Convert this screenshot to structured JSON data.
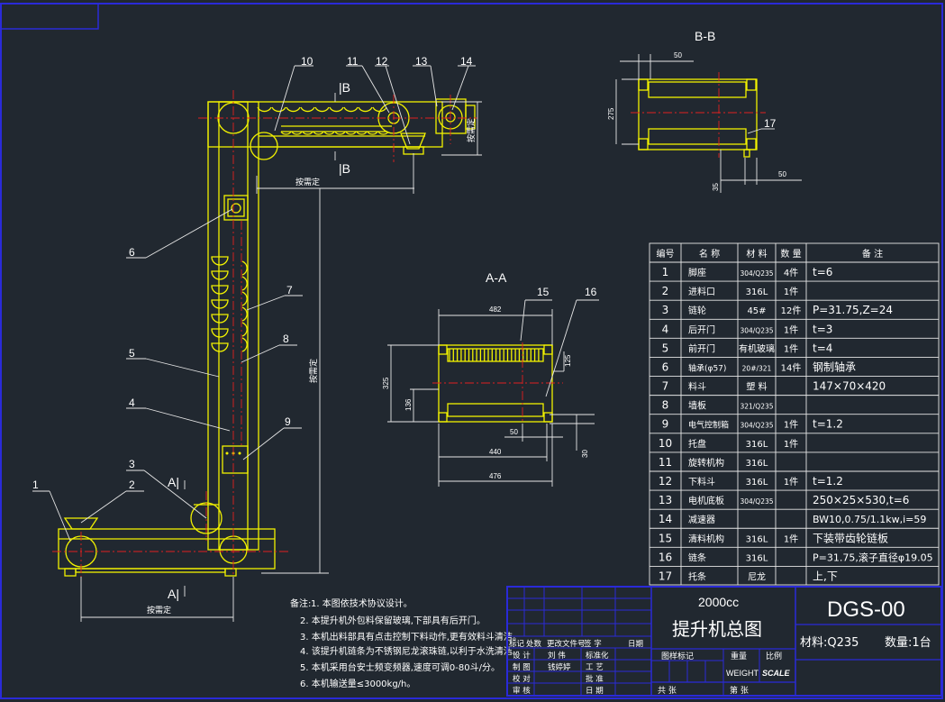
{
  "colors": {
    "background": "#212830",
    "frame_blue": "#2a2ad8",
    "outline_yellow": "#f2f200",
    "centerline_red": "#e02020",
    "text_white": "#ffffff"
  },
  "section_labels": {
    "b_b": "B-B",
    "a_a": "A-A",
    "b_top": "|B",
    "b_bottom": "|B",
    "a_top": "A|",
    "a_bottom": "A|"
  },
  "balloons": [
    "1",
    "2",
    "3",
    "4",
    "5",
    "6",
    "7",
    "8",
    "9",
    "10",
    "11",
    "12",
    "13",
    "14",
    "15",
    "16",
    "17"
  ],
  "dimensions": {
    "bb_50_top": "50",
    "bb_275": "275",
    "bb_35": "35",
    "bb_50_bottom": "50",
    "aa_482": "482",
    "aa_325": "325",
    "aa_136": "136",
    "aa_125": "125",
    "aa_50": "50",
    "aa_440": "440",
    "aa_476": "476",
    "aa_30": "30",
    "main_by_order_1": "按需定",
    "main_by_order_2": "按需定",
    "main_by_order_3": "按需定",
    "main_by_order_4": "按需定"
  },
  "parts_table": {
    "headers": [
      "编号",
      "名  称",
      "材 料",
      "数 量",
      "备     注"
    ],
    "rows": [
      [
        "1",
        "脚座",
        "304/Q235",
        "4件",
        "t=6"
      ],
      [
        "2",
        "进料口",
        "316L",
        "1件",
        ""
      ],
      [
        "3",
        "链轮",
        "45#",
        "12件",
        "P=31.75,Z=24"
      ],
      [
        "4",
        "后开门",
        "304/Q235",
        "1件",
        "t=3"
      ],
      [
        "5",
        "前开门",
        "有机玻璃",
        "1件",
        "t=4"
      ],
      [
        "6",
        "轴承(φ57)",
        "20#/321",
        "14件",
        "钢制轴承"
      ],
      [
        "7",
        "料斗",
        "塑 料",
        "",
        "147×70×420"
      ],
      [
        "8",
        "墙板",
        "321/Q235",
        "",
        ""
      ],
      [
        "9",
        "电气控制箱",
        "304/Q235",
        "1件",
        "t=1.2"
      ],
      [
        "10",
        "托盘",
        "316L",
        "1件",
        ""
      ],
      [
        "11",
        "旋转机构",
        "316L",
        "",
        ""
      ],
      [
        "12",
        "下料斗",
        "316L",
        "1件",
        "t=1.2"
      ],
      [
        "13",
        "电机底板",
        "304/Q235",
        "",
        "250×25×530,t=6"
      ],
      [
        "14",
        "减速器",
        "",
        "",
        "BW10,0.75/1.1kw,i=59"
      ],
      [
        "15",
        "清料机构",
        "316L",
        "1件",
        "下装带齿轮链板"
      ],
      [
        "16",
        "链条",
        "316L",
        "",
        "P=31.75,滚子直径φ19.05"
      ],
      [
        "17",
        "托条",
        "尼龙",
        "",
        "上,下"
      ]
    ]
  },
  "notes": {
    "heading": "备注:",
    "items": [
      "1.  本图依技术协议设计。",
      "2.  本提升机外包料保留玻璃,下部具有后开门。",
      "3.  本机出料部具有点击控制下料动作,更有效料斗清洁。",
      "4.  该提升机链条为不锈钢尼龙滚珠链,以利于水洗清洁。",
      "5.  本机采用台安士频变频器,速度可调0-80斗/分。",
      "6.  本机输送量≤3000kg/h。"
    ]
  },
  "title_block": {
    "capacity": "2000cc",
    "title": "提升机总图",
    "drawing_no": "DGS-00",
    "material": "材料:Q235",
    "quantity": "数量:1台",
    "stage_mark": "图样标记",
    "weight": "重量",
    "scale": "比例",
    "weight_en": "WEIGHT",
    "scale_en": "SCALE",
    "sheets_total": "共    张",
    "sheet_no": "第    张",
    "rev_headers": [
      "标记",
      "处数",
      "更改文件号",
      "签  字",
      "日期"
    ],
    "roles": [
      [
        "设 计",
        "刘 伟",
        "标准化"
      ],
      [
        "制 图",
        "钱婷婷",
        "工 艺"
      ],
      [
        "校 对",
        "",
        "批 准"
      ],
      [
        "审 核",
        "",
        "日 期"
      ]
    ]
  }
}
